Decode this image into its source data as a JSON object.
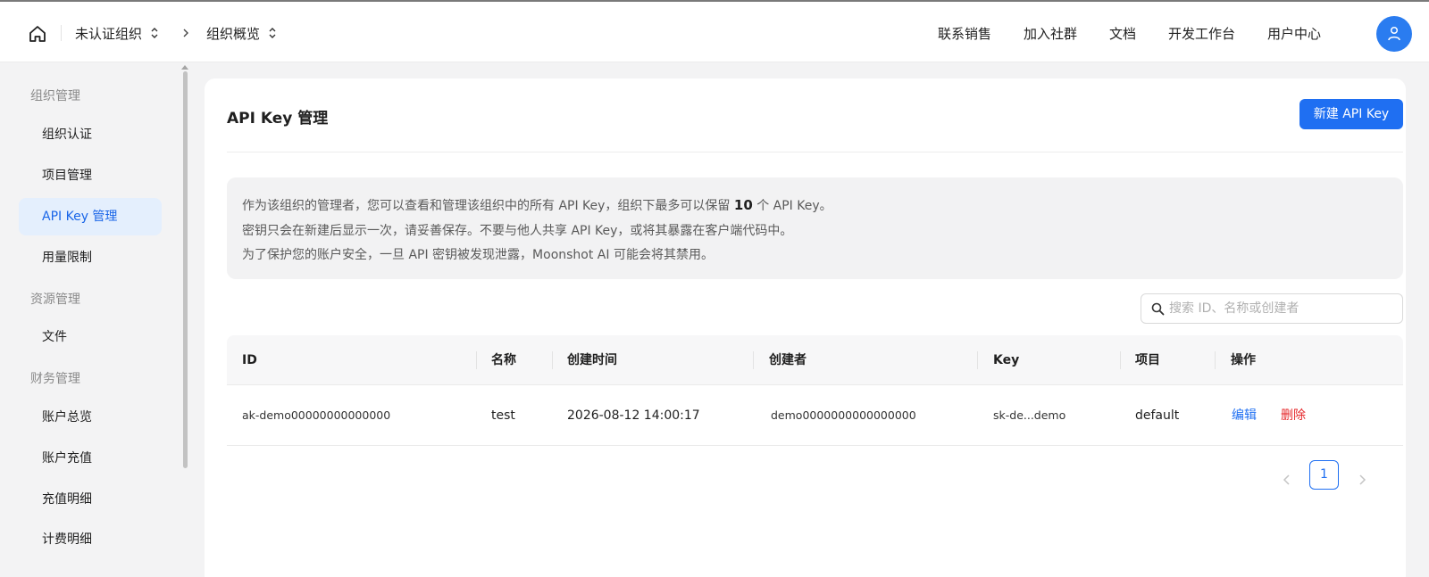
{
  "header": {
    "org_crumb": "未认证组织",
    "page_crumb": "组织概览",
    "nav": [
      "联系销售",
      "加入社群",
      "文档",
      "开发工作台",
      "用户中心"
    ]
  },
  "sidebar": {
    "groups": {
      "org": "组织管理",
      "resource": "资源管理",
      "finance": "财务管理"
    },
    "items": {
      "org_verify": "组织认证",
      "projects": "项目管理",
      "api_keys": "API Key 管理",
      "usage_limits": "用量限制",
      "files": "文件",
      "account_overview": "账户总览",
      "recharge": "账户充值",
      "recharge_details": "充值明细",
      "billing_details": "计费明细"
    },
    "active_item": "api_keys"
  },
  "main": {
    "title": "API Key 管理",
    "new_button": "新建 API Key",
    "notice": {
      "line1_prefix": "作为该组织的管理者，您可以查看和管理该组织中的所有 API Key，组织下最多可以保留 ",
      "line1_count": "10",
      "line1_suffix": " 个 API Key。",
      "line2": "密钥只会在新建后显示一次，请妥善保存。不要与他人共享 API Key，或将其暴露在客户端代码中。",
      "line3": "为了保护您的账户安全，一旦 API 密钥被发现泄露，Moonshot AI 可能会将其禁用。"
    },
    "search_placeholder": "搜索 ID、名称或创建者",
    "table": {
      "columns": [
        "ID",
        "名称",
        "创建时间",
        "创建者",
        "Key",
        "项目",
        "操作"
      ],
      "rows": [
        {
          "id": "ak-demo00000000000000",
          "name": "test",
          "created_at": "2026-08-12 14:00:17",
          "creator": "demo0000000000000000",
          "key": "sk-de...demo",
          "project": "default",
          "edit": "编辑",
          "delete": "删除"
        }
      ]
    },
    "pagination": {
      "current_page": "1"
    }
  },
  "colors": {
    "accent": "#1f6ff2",
    "active_bg": "#e4effd",
    "danger": "#e5272a",
    "avatar": "#2a7cf0"
  },
  "icons": [
    "home-icon",
    "chevron-updown-icon",
    "chevron-right-icon",
    "user-icon",
    "search-icon",
    "chevron-left-icon"
  ]
}
